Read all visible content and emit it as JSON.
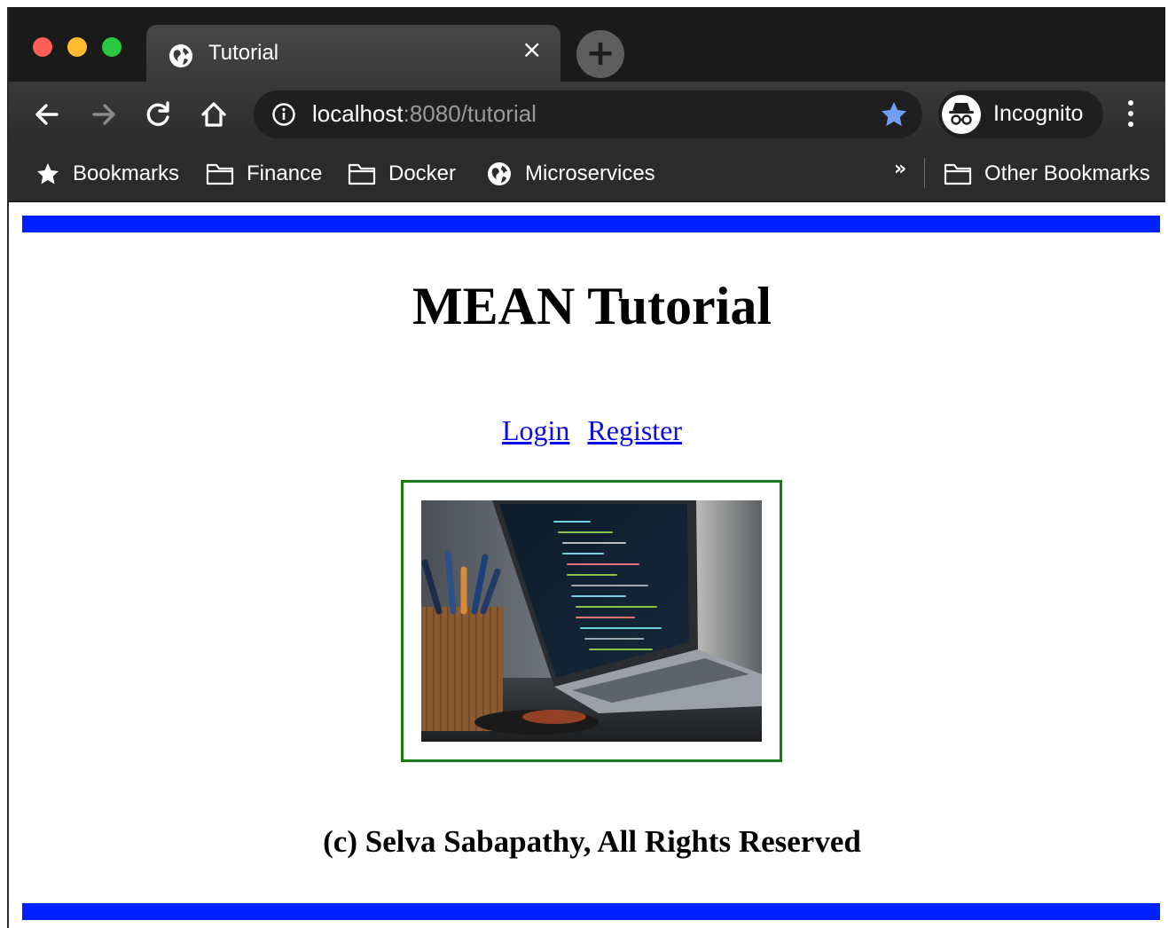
{
  "browser": {
    "tab": {
      "title": "Tutorial",
      "close_glyph": "×"
    },
    "new_tab_glyph": "+",
    "url": {
      "host": "localhost",
      "path": ":8080/tutorial"
    },
    "profile_label": "Incognito",
    "bookmarks": [
      {
        "label": "Bookmarks",
        "icon": "star-icon"
      },
      {
        "label": "Finance",
        "icon": "folder-icon"
      },
      {
        "label": "Docker",
        "icon": "folder-icon"
      },
      {
        "label": "Microservices",
        "icon": "globe-icon"
      }
    ],
    "overflow_glyph": "»",
    "other_bookmarks": "Other Bookmarks"
  },
  "page": {
    "title": "MEAN Tutorial",
    "links": {
      "login": "Login",
      "register": "Register"
    },
    "footer": "(c) Selva Sabapathy, All Rights Reserved",
    "accent_color": "#0020ff",
    "frame_color": "#1a7a1a",
    "link_color": "#0a0aee"
  }
}
